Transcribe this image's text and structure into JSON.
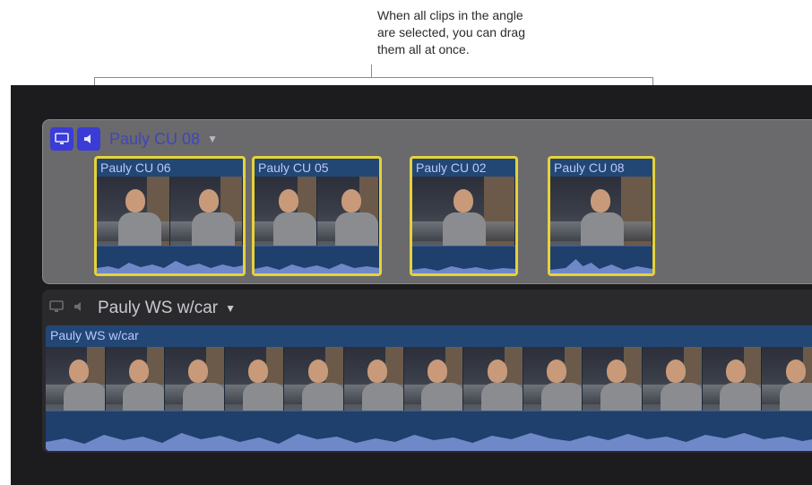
{
  "callout": {
    "lines": [
      "When all clips in the angle",
      "are selected, you can drag",
      "them all at once."
    ]
  },
  "active_angle": {
    "title": "Pauly CU 08",
    "video_icon": "monitor-icon",
    "audio_icon": "speaker-icon",
    "chevron": "chevron-down-icon",
    "clips": [
      {
        "label": "Pauly CU 06"
      },
      {
        "label": "Pauly CU 05"
      },
      {
        "label": "Pauly CU 02"
      },
      {
        "label": "Pauly CU 08"
      }
    ],
    "selection_color": "#e6d23a",
    "accent_color": "#3b3bd6"
  },
  "second_angle": {
    "title": "Pauly WS w/car",
    "video_icon": "monitor-icon",
    "audio_icon": "speaker-icon",
    "chevron": "chevron-down-icon",
    "clip_label": "Pauly WS w/car"
  }
}
